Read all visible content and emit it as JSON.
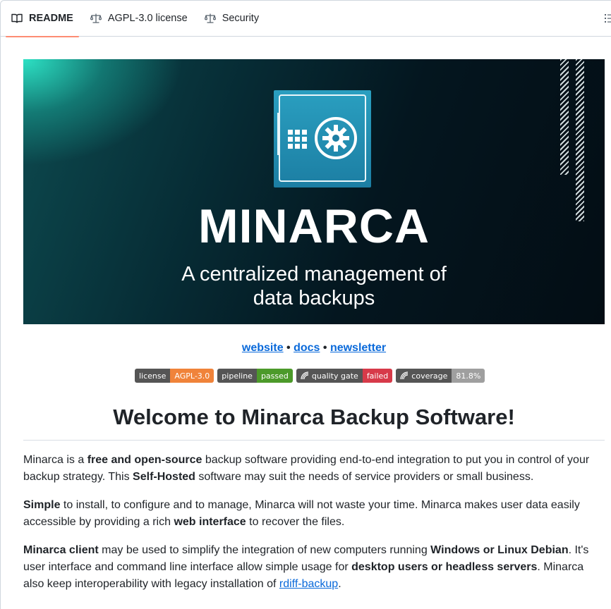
{
  "tabs": [
    {
      "label": "README",
      "icon": "book-icon",
      "active": true
    },
    {
      "label": "AGPL-3.0 license",
      "icon": "scale-icon",
      "active": false
    },
    {
      "label": "Security",
      "icon": "scale-icon",
      "active": false
    }
  ],
  "banner": {
    "title": "MINARCA",
    "subtitle_line1": "A centralized management of",
    "subtitle_line2": "data backups"
  },
  "links": {
    "website": "website",
    "docs": "docs",
    "newsletter": "newsletter",
    "separator": " • "
  },
  "badges": [
    {
      "key": "license",
      "value": "AGPL-3.0",
      "color": "#f0833a",
      "icon": ""
    },
    {
      "key": "pipeline",
      "value": "passed",
      "color": "#4c9a2a",
      "icon": ""
    },
    {
      "key": "quality gate",
      "value": "failed",
      "color": "#d73a49",
      "icon": "sonar-icon"
    },
    {
      "key": "coverage",
      "value": "81.8%",
      "color": "#9f9f9f",
      "icon": "sonar-icon"
    }
  ],
  "heading": "Welcome to Minarca Backup Software!",
  "paragraphs": {
    "p1": {
      "t1": "Minarca is a ",
      "b1": "free and open-source",
      "t2": " backup software providing end-to-end integration to put you in control of your backup strategy. This ",
      "b2": "Self-Hosted",
      "t3": " software may suit the needs of service providers or small business."
    },
    "p2": {
      "b1": "Simple",
      "t1": " to install, to configure and to manage, Minarca will not waste your time. Minarca makes user data easily accessible by providing a rich ",
      "b2": "web interface",
      "t2": " to recover the files."
    },
    "p3": {
      "b1": "Minarca client",
      "t1": " may be used to simplify the integration of new computers running ",
      "b2": "Windows or Linux Debian",
      "t2": ". It's user interface and command line interface allow simple usage for ",
      "b3": "desktop users or headless servers",
      "t3": ". Minarca also keep interoperability with legacy installation of ",
      "link": "rdiff-backup",
      "t4": "."
    }
  },
  "colors": {
    "link": "#0969da",
    "active_tab_underline": "#fd8c73",
    "logo_blue": "#2a9fc0"
  }
}
